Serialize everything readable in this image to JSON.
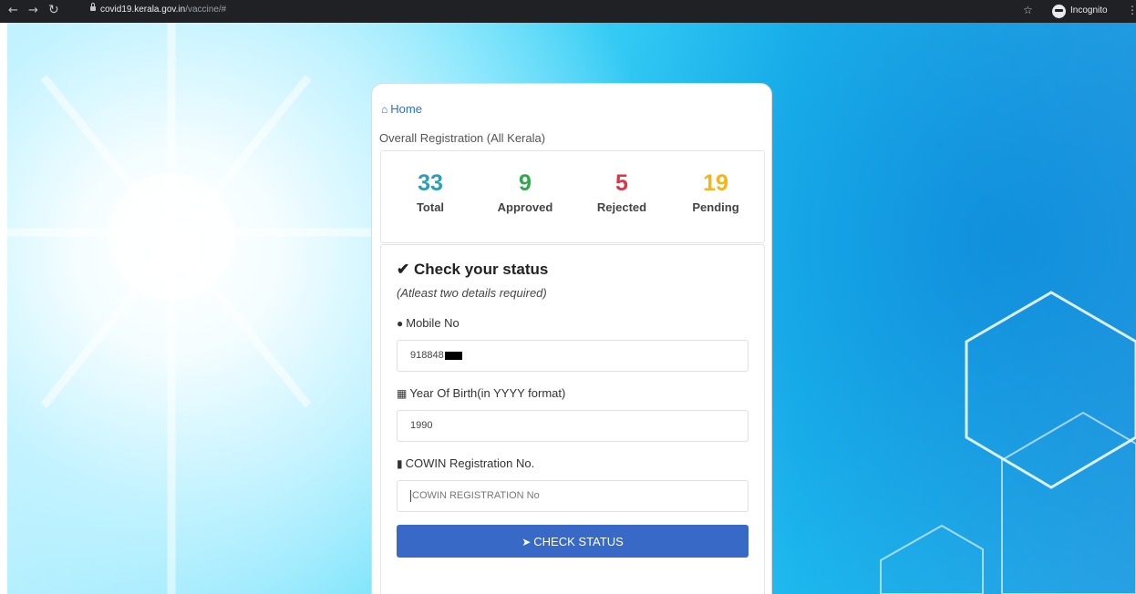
{
  "browser": {
    "url_domain": "covid19.kerala.gov.in",
    "url_path": "/vaccine/#",
    "incognito_label": "Incognito"
  },
  "icons": {
    "back": "back-arrow-icon",
    "forward": "forward-arrow-icon",
    "reload": "reload-icon",
    "lock": "lock-icon",
    "star": "star-icon",
    "incognito": "incognito-icon",
    "menu": "kebab-menu-icon",
    "home": "home-icon",
    "check": "checkmark-icon",
    "user": "user-circle-icon",
    "calendar": "calendar-icon",
    "file": "file-icon",
    "send": "paper-plane-icon"
  },
  "page": {
    "home_label": "Home",
    "overall_label": "Overall Registration (All Kerala)"
  },
  "stats": [
    {
      "value": "33",
      "label": "Total",
      "color": "#2aa0b5"
    },
    {
      "value": "9",
      "label": "Approved",
      "color": "#2fa84f"
    },
    {
      "value": "5",
      "label": "Rejected",
      "color": "#dc3545"
    },
    {
      "value": "19",
      "label": "Pending",
      "color": "#f5b518"
    }
  ],
  "form": {
    "title": "Check your status",
    "subtitle": "(Atleast two details required)",
    "mobile_label": "Mobile No",
    "mobile_value": "918848",
    "yob_label": "Year Of Birth(in YYYY format)",
    "yob_value": "1990",
    "cowin_label": "COWIN Registration No.",
    "cowin_placeholder": "COWIN REGISTRATION No",
    "button_label": "CHECK STATUS"
  },
  "colors": {
    "link": "#1a73e8",
    "button": "#3869c6"
  }
}
